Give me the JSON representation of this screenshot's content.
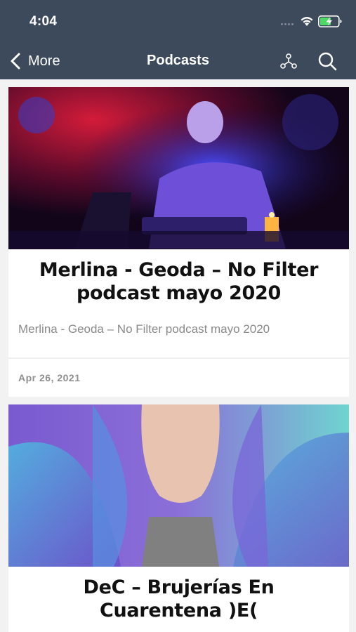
{
  "status_bar": {
    "time": "4:04"
  },
  "nav": {
    "back_label": "More",
    "title": "Podcasts"
  },
  "posts": [
    {
      "title": "Merlina - Geoda – No Filter podcast mayo 2020",
      "excerpt": "Merlina - Geoda – No Filter podcast mayo 2020",
      "date": "Apr 26, 2021"
    },
    {
      "title": "DeC – Brujerías En Cuarentena )E("
    }
  ],
  "colors": {
    "header_bg": "#3d4a5c",
    "page_bg": "#f2f2f2",
    "battery": "#4cd964"
  },
  "icons": [
    "chevron-left-icon",
    "network-icon",
    "search-icon",
    "wifi-icon",
    "battery-icon"
  ]
}
